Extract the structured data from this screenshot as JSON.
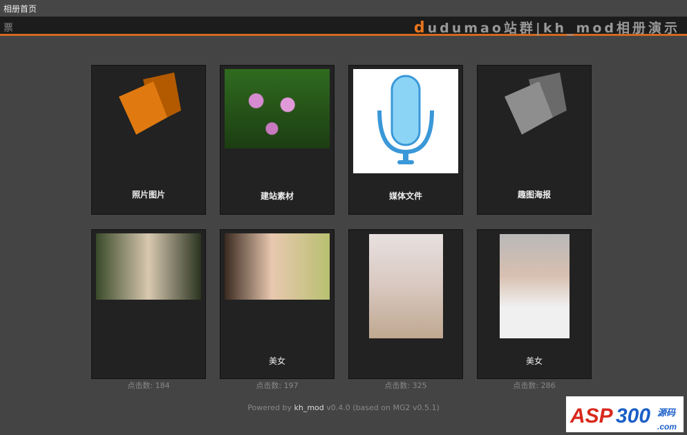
{
  "topbar": {
    "title": "相册首页"
  },
  "header": {
    "left_glyph": "票",
    "brand_first": "d",
    "brand_rest": "udumao站群|kh_mod相册演示"
  },
  "albums": [
    {
      "title": "照片图片",
      "icon": "orange-folder-icon"
    },
    {
      "title": "建站素材",
      "icon": "lotus-photo"
    },
    {
      "title": "媒体文件",
      "icon": "microphone-icon"
    },
    {
      "title": "趣图海报",
      "icon": "gray-folder-icon"
    }
  ],
  "photos": [
    {
      "title": "",
      "count": "点击数: 184"
    },
    {
      "title": "美女",
      "count": "点击数: 197"
    },
    {
      "title": "",
      "count": "点击数: 325"
    },
    {
      "title": "美女",
      "count": "点击数: 286"
    }
  ],
  "footer": {
    "prefix": "Powered by ",
    "link": "kh_mod",
    "suffix": " v0.4.0 (based on MG2 v0.5.1)"
  },
  "watermark": {
    "text": "ASP300源码 .com"
  },
  "colors": {
    "accent": "#e8741c",
    "bg": "#444444",
    "card": "#222222"
  }
}
